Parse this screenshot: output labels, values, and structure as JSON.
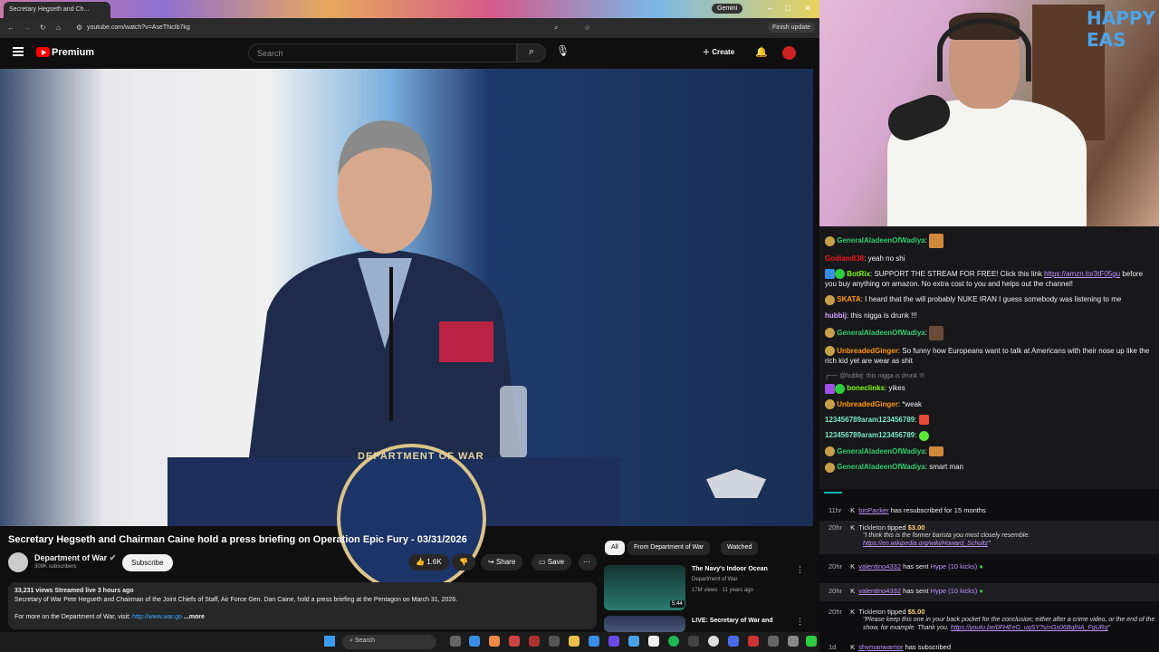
{
  "browser": {
    "tab_title": "Secretary Hegseth and Ch...",
    "gemini_label": "Gemini",
    "url": "youtube.com/watch?v=AseTNcIb7kg",
    "finish_update": "Finish update"
  },
  "yt": {
    "logo_text": "Premium",
    "search_placeholder": "Search",
    "create_label": "Create",
    "video_title": "Secretary Hegseth and Chairman Caine hold a press briefing on Operation Epic Fury - 03/31/2026",
    "channel_name": "Department of War",
    "subscribers": "309K subscribers",
    "subscribe_label": "Subscribe",
    "likes": "1.6K",
    "share_label": "Share",
    "save_label": "Save",
    "seal_text": "DEPARTMENT OF WAR",
    "desc_stats": "33,231 views  Streamed live 3 hours ago",
    "desc_line1": "Secretary of War Pete Hegseth and Chairman of the Joint Chiefs of Staff, Air Force Gen. Dan Caine, hold a press briefing at the Pentagon on March 31, 2026.",
    "desc_line2": "For more on the Department of War, visit:",
    "desc_link": "http://www.war.go",
    "desc_more": "...more",
    "chips": [
      "All",
      "From Department of War",
      "Watched"
    ],
    "recommendations": [
      {
        "title": "The Navy's Indoor Ocean",
        "channel": "Department of War",
        "meta": "17M views · 11 years ago",
        "duration": "5:44"
      },
      {
        "title": "LIVE: Secretary of War and",
        "channel": "",
        "meta": "",
        "duration": ""
      }
    ]
  },
  "taskbar": {
    "search_label": "Search"
  },
  "stream": {
    "easter_text": "HAPPY EAS"
  },
  "chat": [
    {
      "user": "GeneralAladeenOfWadiya",
      "color": "#2ecc71",
      "text": ""
    },
    {
      "user": "Godlam838",
      "color": "#e91916",
      "text": "yeah no shi"
    },
    {
      "user": "BotRix",
      "color": "#7cfc00",
      "text": "SUPPORT THE STREAM FOR FREE! Click this link",
      "link": "https://amzn.to/3tF05gu",
      "text2": "before you buy anything on amazon. No extra cost to you and helps out the channel!"
    },
    {
      "user": "SKATA",
      "color": "#ff9800",
      "text": "I heard that the will probably NUKE IRAN I guess somebody was listening to me"
    },
    {
      "user": "hubbij",
      "color": "#d6a0ff",
      "text": "this nigga is drunk !!!"
    },
    {
      "user": "GeneralAladeenOfWadiya",
      "color": "#2ecc71",
      "text": ""
    },
    {
      "user": "UnbreadedGinger",
      "color": "#ff9800",
      "text": "So funny how Europeans want to talk at Americans with their nose up like the rich kid yet are wear as shit"
    },
    {
      "reply": "@hubbij: this nigga is drunk !!!"
    },
    {
      "user": "boneclinks",
      "color": "#7cfc00",
      "text": "yikes"
    },
    {
      "user": "UnbreadedGinger",
      "color": "#ff9800",
      "text": "*weak"
    },
    {
      "user": "123456789aram123456789",
      "color": "#7ee8c8",
      "text": ""
    },
    {
      "user": "123456789aram123456789",
      "color": "#7ee8c8",
      "text": ""
    },
    {
      "user": "GeneralAladeenOfWadiya",
      "color": "#2ecc71",
      "text": ""
    },
    {
      "user": "GeneralAladeenOfWadiya",
      "color": "#2ecc71",
      "text": "smart man"
    }
  ],
  "events": [
    {
      "time": "11hr",
      "name": "binPacker",
      "text": "has resubscribed for 15 months"
    },
    {
      "time": "20hr",
      "name": "Tickleton",
      "text": "tipped",
      "amount": "$3.00",
      "quote": "\"I think this is the former barista you most closely resemble:",
      "quote_link": "https://en.wikipedia.org/wiki/Howard_Schultz",
      "quote_end": "\""
    },
    {
      "time": "20hr",
      "name": "valentino4332",
      "text": "has sent",
      "amount": "Hype (10 kicks)"
    },
    {
      "time": "20hr",
      "name": "valentino4332",
      "text": "has sent",
      "amount": "Hype (10 kicks)"
    },
    {
      "time": "20hr",
      "name": "Tickleton",
      "text": "tipped",
      "amount": "$5.00",
      "quote": "\"Please keep this one in your back pocket for the conclusion; either after a crime video, or the end of the show, for example. Thank you.",
      "quote_link": "https://youtu.be/0FHEeG_uqSY?si=Gs06BqlNA_FqURg",
      "quote_end": "\""
    },
    {
      "time": "1d",
      "name": "shymanwarrior",
      "text": "has subscribed"
    }
  ]
}
